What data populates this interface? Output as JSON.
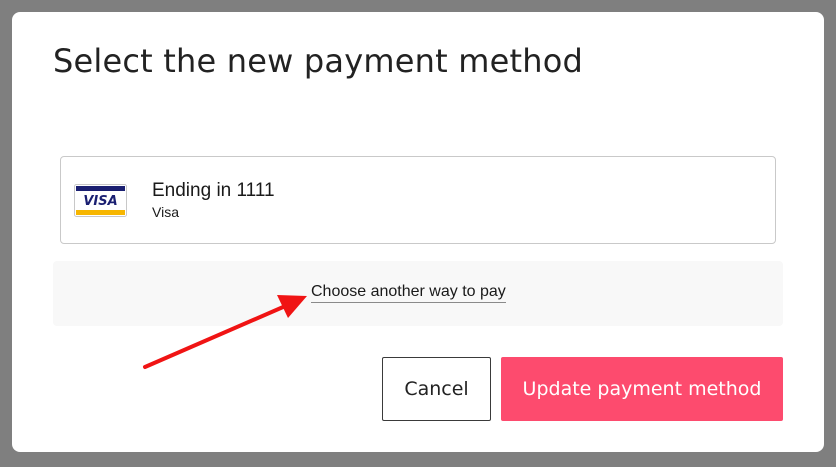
{
  "dialog": {
    "title": "Select the new payment method"
  },
  "saved_card": {
    "ending_text": "Ending in 1111",
    "brand": "Visa",
    "logo_text": "VISA",
    "icon": "visa-card-icon"
  },
  "alternative": {
    "link_text": "Choose another way to pay"
  },
  "annotation": {
    "icon": "red-arrow-pointer",
    "color": "#f01414"
  },
  "actions": {
    "cancel_label": "Cancel",
    "update_label": "Update payment method"
  },
  "colors": {
    "primary_button": "#fd4b6e",
    "overlay": "#7f7f7f"
  }
}
